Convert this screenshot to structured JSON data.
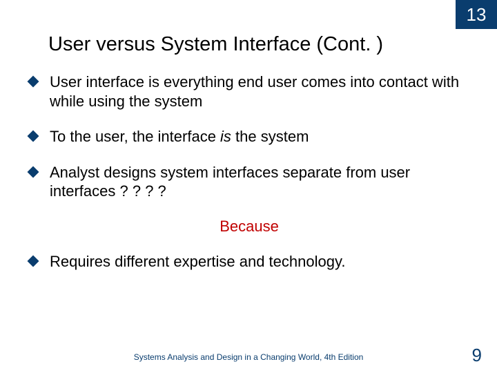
{
  "chapter": "13",
  "title": "User versus System Interface (Cont. )",
  "bullets": {
    "b1": "User interface is everything end user comes into contact with while using the system",
    "b2_pre": "To the user, the interface ",
    "b2_em": "is",
    "b2_post": " the system",
    "b3": "Analyst designs system interfaces separate from user interfaces ? ? ? ?",
    "b4": "Requires different expertise and technology."
  },
  "callout": "Because",
  "footer": "Systems Analysis and Design in a Changing World, 4th Edition",
  "page": "9"
}
